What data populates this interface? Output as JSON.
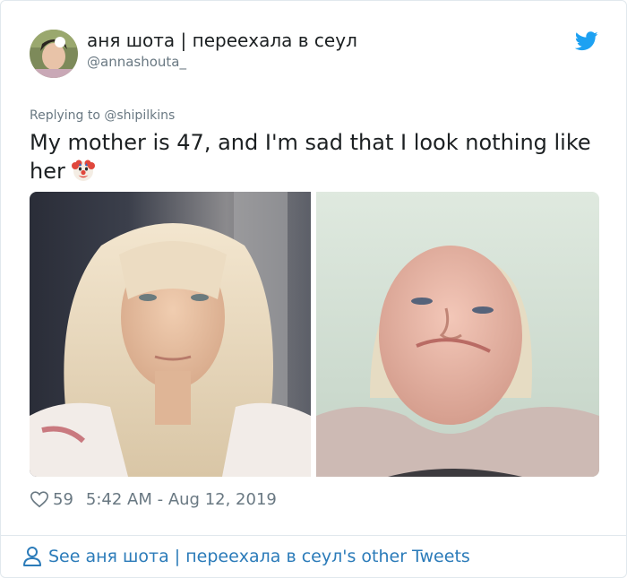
{
  "tweet": {
    "author_name": "аня шота | переехала в сеул",
    "author_handle": "@annashouta_",
    "replying_to": "Replying to @shipilkins",
    "text": "My mother is 47, and I'm sad that I look nothing like her",
    "emoji": "clown-face-emoji",
    "likes": "59",
    "timestamp": "5:42 AM - Aug 12, 2019",
    "footer_link": "See аня шота | переехала в сеул's other Tweets"
  },
  "photos": [
    {
      "label": "daughter-selfie"
    },
    {
      "label": "mother-selfie"
    }
  ],
  "colors": {
    "text": "#1c2022",
    "secondary": "#697882",
    "link": "#2b7bb9",
    "twitter_blue": "#1da1f2",
    "border": "#e1e8ed"
  }
}
